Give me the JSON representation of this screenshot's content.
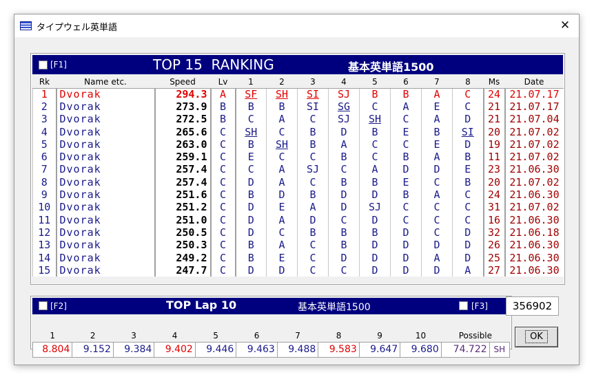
{
  "window": {
    "title": "タイプウェル英単語"
  },
  "ranking": {
    "fkey": "[F1]",
    "title": "TOP 15  RANKING",
    "course": "基本英単語1500",
    "columns": [
      "Rk",
      "Name etc.",
      "Speed",
      "Lv",
      "1",
      "2",
      "3",
      "4",
      "5",
      "6",
      "7",
      "8",
      "Ms",
      "Date"
    ],
    "rows": [
      {
        "rk": "1",
        "name": "Dvorak",
        "speed": "294.3",
        "lv": "A",
        "g": [
          "SF",
          "SH",
          "SI",
          "SJ",
          "B",
          "B",
          "A",
          "C"
        ],
        "ms": "24",
        "date": "21.07.17"
      },
      {
        "rk": "2",
        "name": "Dvorak",
        "speed": "273.9",
        "lv": "B",
        "g": [
          "B",
          "B",
          "SI",
          "SG",
          "C",
          "A",
          "E",
          "C"
        ],
        "ms": "21",
        "date": "21.07.17"
      },
      {
        "rk": "3",
        "name": "Dvorak",
        "speed": "272.5",
        "lv": "B",
        "g": [
          "C",
          "A",
          "C",
          "SJ",
          "SH",
          "C",
          "A",
          "D"
        ],
        "ms": "21",
        "date": "21.07.04"
      },
      {
        "rk": "4",
        "name": "Dvorak",
        "speed": "265.6",
        "lv": "C",
        "g": [
          "SH",
          "C",
          "B",
          "D",
          "B",
          "E",
          "B",
          "SI"
        ],
        "ms": "20",
        "date": "21.07.02"
      },
      {
        "rk": "5",
        "name": "Dvorak",
        "speed": "263.0",
        "lv": "C",
        "g": [
          "B",
          "SH",
          "B",
          "A",
          "C",
          "C",
          "E",
          "D"
        ],
        "ms": "19",
        "date": "21.07.02"
      },
      {
        "rk": "6",
        "name": "Dvorak",
        "speed": "259.1",
        "lv": "C",
        "g": [
          "E",
          "C",
          "C",
          "B",
          "C",
          "B",
          "A",
          "B"
        ],
        "ms": "11",
        "date": "21.07.02"
      },
      {
        "rk": "7",
        "name": "Dvorak",
        "speed": "257.4",
        "lv": "C",
        "g": [
          "C",
          "A",
          "SJ",
          "C",
          "A",
          "D",
          "D",
          "E"
        ],
        "ms": "23",
        "date": "21.06.30"
      },
      {
        "rk": "8",
        "name": "Dvorak",
        "speed": "257.4",
        "lv": "C",
        "g": [
          "D",
          "A",
          "C",
          "B",
          "B",
          "E",
          "C",
          "B"
        ],
        "ms": "20",
        "date": "21.07.02"
      },
      {
        "rk": "9",
        "name": "Dvorak",
        "speed": "251.6",
        "lv": "C",
        "g": [
          "B",
          "D",
          "B",
          "D",
          "D",
          "B",
          "A",
          "C"
        ],
        "ms": "24",
        "date": "21.06.30"
      },
      {
        "rk": "10",
        "name": "Dvorak",
        "speed": "251.2",
        "lv": "C",
        "g": [
          "D",
          "E",
          "A",
          "D",
          "SJ",
          "C",
          "C",
          "C"
        ],
        "ms": "31",
        "date": "21.07.02"
      },
      {
        "rk": "11",
        "name": "Dvorak",
        "speed": "251.0",
        "lv": "C",
        "g": [
          "D",
          "A",
          "D",
          "C",
          "D",
          "C",
          "C",
          "C"
        ],
        "ms": "16",
        "date": "21.06.30"
      },
      {
        "rk": "12",
        "name": "Dvorak",
        "speed": "250.5",
        "lv": "C",
        "g": [
          "D",
          "C",
          "B",
          "B",
          "B",
          "D",
          "C",
          "D"
        ],
        "ms": "32",
        "date": "21.06.18"
      },
      {
        "rk": "13",
        "name": "Dvorak",
        "speed": "250.3",
        "lv": "C",
        "g": [
          "B",
          "A",
          "C",
          "B",
          "D",
          "D",
          "D",
          "D"
        ],
        "ms": "26",
        "date": "21.06.30"
      },
      {
        "rk": "14",
        "name": "Dvorak",
        "speed": "249.2",
        "lv": "C",
        "g": [
          "B",
          "E",
          "C",
          "D",
          "D",
          "D",
          "A",
          "D"
        ],
        "ms": "25",
        "date": "21.06.30"
      },
      {
        "rk": "15",
        "name": "Dvorak",
        "speed": "247.7",
        "lv": "C",
        "g": [
          "D",
          "D",
          "C",
          "C",
          "D",
          "D",
          "D",
          "A"
        ],
        "ms": "27",
        "date": "21.06.30"
      }
    ],
    "underlined": [
      [
        0,
        0
      ],
      [
        0,
        1
      ],
      [
        0,
        2
      ],
      [
        1,
        3
      ],
      [
        2,
        4
      ],
      [
        3,
        0
      ],
      [
        3,
        7
      ],
      [
        4,
        1
      ]
    ],
    "highlight_row": 0
  },
  "laps": {
    "fkey_left": "[F2]",
    "title": "TOP Lap 10",
    "course": "基本英単語1500",
    "fkey_right": "[F3]",
    "headers": [
      "1",
      "2",
      "3",
      "4",
      "5",
      "6",
      "7",
      "8",
      "9",
      "10",
      "Possible"
    ],
    "values": [
      "8.804",
      "9.152",
      "9.384",
      "9.402",
      "9.446",
      "9.463",
      "9.488",
      "9.583",
      "9.647",
      "9.680",
      "74.722"
    ],
    "red_indices": [
      0,
      3,
      7
    ],
    "possible_suffix": "SH"
  },
  "score": "356902",
  "ok_label": "OK",
  "colors": {
    "header_bg": "#00007f",
    "red": "#e00000",
    "blue": "#1a1a8a",
    "darkred": "#a00000"
  }
}
